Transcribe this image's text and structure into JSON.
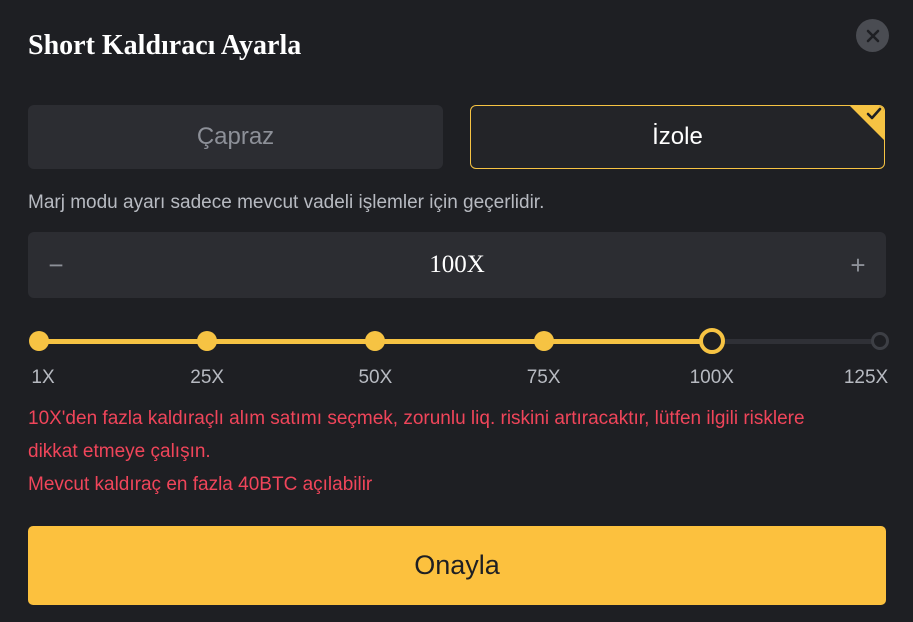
{
  "dialog": {
    "title": "Short Kaldıracı Ayarla",
    "close_icon": "close-icon"
  },
  "margin_mode": {
    "options": [
      {
        "label": "Çapraz",
        "selected": false
      },
      {
        "label": "İzole",
        "selected": true
      }
    ],
    "selected_indicator_icon": "check-icon",
    "note": "Marj modu ayarı sadece mevcut vadeli işlemler için geçerlidir."
  },
  "leverage": {
    "decrease_symbol": "−",
    "increase_symbol": "+",
    "value": "100X",
    "current": 100,
    "min": 1,
    "max": 125
  },
  "slider": {
    "ticks": [
      "1X",
      "25X",
      "50X",
      "75X",
      "100X",
      "125X"
    ]
  },
  "warnings": {
    "line1": "10X'den fazla kaldıraçlı alım satımı seçmek, zorunlu liq. riskini artıracaktır, lütfen ilgili risklere",
    "line2": "dikkat etmeye çalışın.",
    "line3": "Mevcut kaldıraç en fazla 40BTC açılabilir"
  },
  "confirm_label": "Onayla",
  "colors": {
    "accent": "#f6c343",
    "background": "#1e1f23",
    "warning": "#f0455a"
  }
}
